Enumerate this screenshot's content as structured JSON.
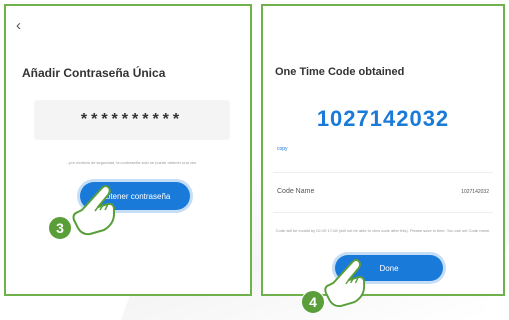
{
  "left_screen": {
    "back_icon": "chevron-left-icon",
    "title": "Añadir Contraseña Única",
    "password_mask": "**********",
    "hint": "...por motivos de seguridad, la contraseña solo se puede obtener una vez",
    "button_label": "Obtener contraseña"
  },
  "right_screen": {
    "title": "One Time Code obtained",
    "code": "1027142032",
    "copy_label": "copy",
    "code_name_label": "Code Name",
    "code_name_value": "1027142032",
    "hint": "Code will be invalid by 02-09 17:08 (will not be able to view code after this). Please save in time. You can set Code name.",
    "button_label": "Done"
  },
  "steps": {
    "step_3": "3",
    "step_4": "4"
  },
  "colors": {
    "accent_blue": "#1a7ad9",
    "frame_green": "#6fb14a",
    "badge_green": "#5a9e3a"
  }
}
